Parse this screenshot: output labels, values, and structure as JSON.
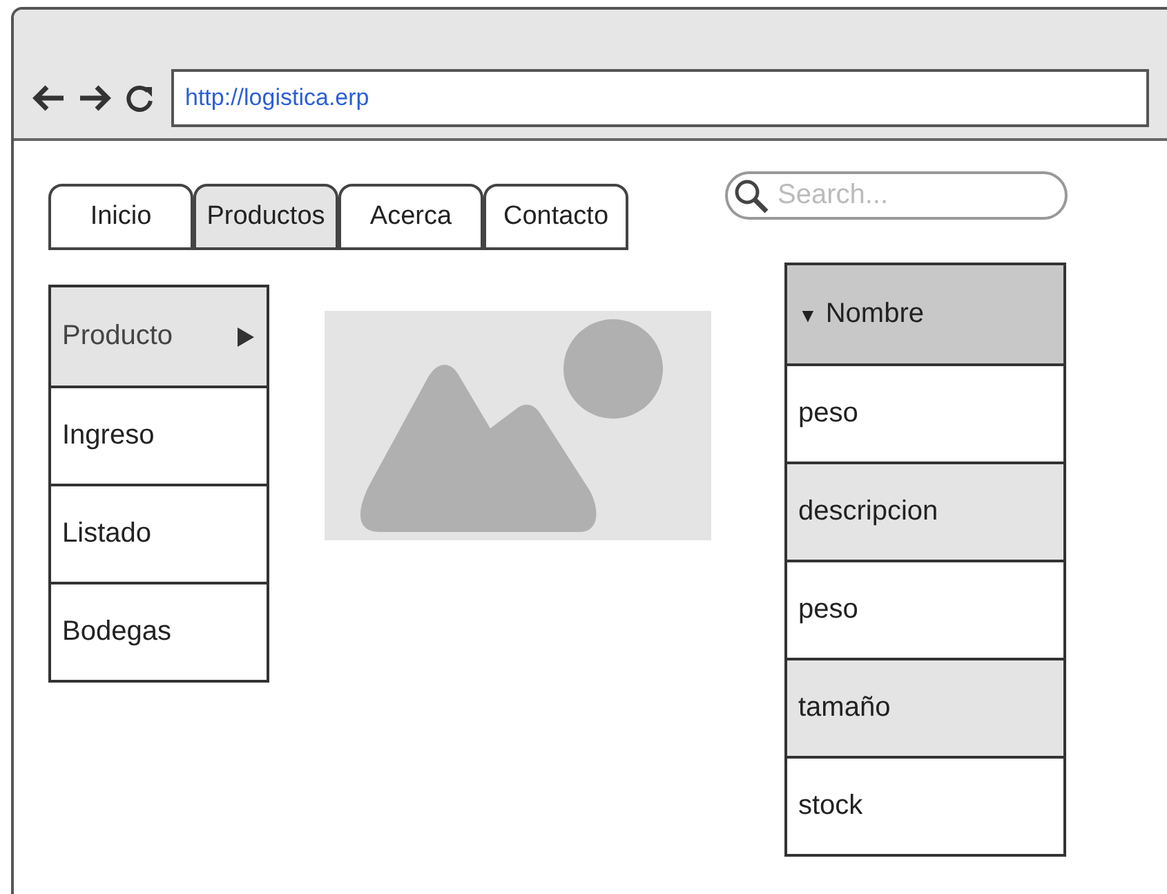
{
  "browser": {
    "url": "http://logistica.erp"
  },
  "tabs": [
    {
      "label": "Inicio",
      "selected": false
    },
    {
      "label": "Productos",
      "selected": true
    },
    {
      "label": "Acerca",
      "selected": false
    },
    {
      "label": "Contacto",
      "selected": false
    }
  ],
  "search": {
    "placeholder": "Search..."
  },
  "menu": [
    {
      "label": "Producto",
      "selected": true,
      "has_submenu": true
    },
    {
      "label": "Ingreso",
      "selected": false,
      "has_submenu": false
    },
    {
      "label": "Listado",
      "selected": false,
      "has_submenu": false
    },
    {
      "label": "Bodegas",
      "selected": false,
      "has_submenu": false
    }
  ],
  "list": {
    "sort_icon": "▼",
    "header": "Nombre",
    "rows": [
      "peso",
      "descripcion",
      "peso",
      "tamaño",
      "stock"
    ]
  }
}
